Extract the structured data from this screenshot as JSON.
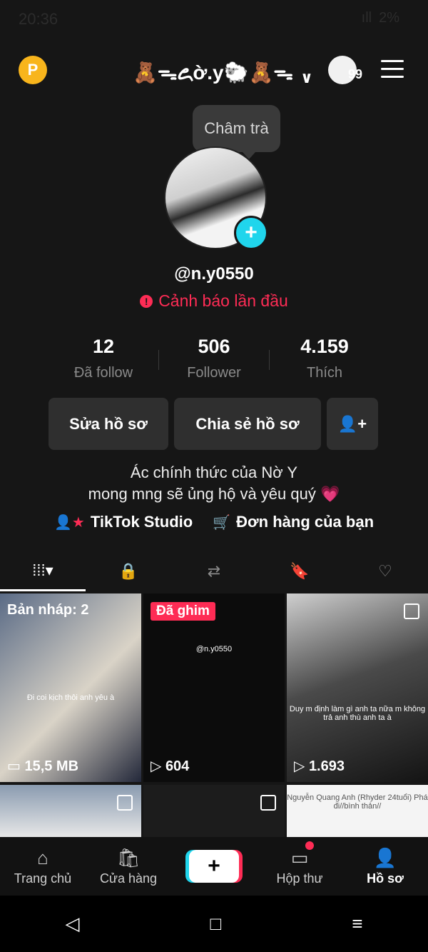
{
  "status_bar": {
    "time": "20:36",
    "signal": "ıll",
    "battery": "2%"
  },
  "header": {
    "coin_label": "P",
    "username_title": "🧸ᯓ꧖ờ.y🐑🧸ᯓ",
    "chevron": "∨",
    "notification_count": "99"
  },
  "tooltip": {
    "text": "Châm trà"
  },
  "profile": {
    "avatar_add_icon": "+",
    "handle": "@n.y0550",
    "warning_icon": "!",
    "warning_text": "Cảnh báo lần đầu"
  },
  "stats": [
    {
      "value": "12",
      "label": "Đã follow"
    },
    {
      "value": "506",
      "label": "Follower"
    },
    {
      "value": "4.159",
      "label": "Thích"
    }
  ],
  "buttons": {
    "edit": "Sửa hồ sơ",
    "share": "Chia sẻ hồ sơ",
    "add_friend_icon": "👤+"
  },
  "bio": {
    "line1": "Ác chính thức của Nờ Y",
    "line2": "mong mng sẽ ủng hộ và yêu quý 💗"
  },
  "links": [
    {
      "icon": "👤★",
      "label": "TikTok Studio"
    },
    {
      "icon": "🛒",
      "label": "Đơn hàng của bạn"
    }
  ],
  "tabs": [
    {
      "icon": "⁞⁞⁞▾",
      "name": "videos"
    },
    {
      "icon": "🔒",
      "name": "private"
    },
    {
      "icon": "⇄",
      "name": "reposts"
    },
    {
      "icon": "🔖",
      "name": "favorites"
    },
    {
      "icon": "♡",
      "name": "liked"
    }
  ],
  "grid": [
    {
      "tag": "Bản nháp: 2",
      "bottom": "▭ 15,5 MB",
      "caption": "Đi coi kịch thôi anh yêu à"
    },
    {
      "pin": "Đã ghim",
      "bottom": "▷ 604",
      "caption": "@n.y0550"
    },
    {
      "bottom": "▷ 1.693",
      "caption": "Duy m định làm gì anh ta nữa m không trả anh thù anh ta à"
    },
    {
      "bottom": "",
      "caption": ""
    },
    {
      "bottom": "",
      "caption": ""
    },
    {
      "bottom": "",
      "caption": "Nguyễn Quang Anh (Rhyder 24tuổi) Phá đi//bình thản//"
    }
  ],
  "bottom_nav": [
    {
      "icon": "⌂",
      "label": "Trang chủ"
    },
    {
      "icon": "🛍",
      "label": "Cửa hàng"
    },
    {
      "icon": "+",
      "label": ""
    },
    {
      "icon": "▭",
      "label": "Hộp thư"
    },
    {
      "icon": "👤",
      "label": "Hồ sơ"
    }
  ],
  "system_nav": {
    "back": "◁",
    "home": "□",
    "recents": "≡"
  },
  "colors": {
    "accent_red": "#fe2c55",
    "accent_cyan": "#20d5ec",
    "coin": "#f8b51c"
  }
}
